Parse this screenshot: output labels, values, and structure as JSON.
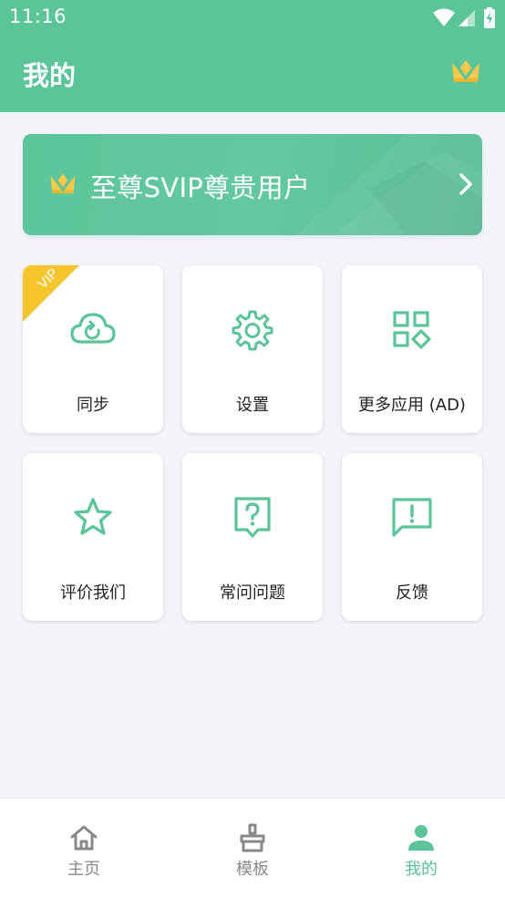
{
  "status_bar": {
    "time": "11:16"
  },
  "header": {
    "title": "我的",
    "crown_icon": "crown-icon"
  },
  "banner": {
    "text": "至尊SVIP尊贵用户",
    "icon": "crown-icon",
    "arrow_icon": "chevron-right-icon"
  },
  "grid": {
    "items": [
      {
        "label": "同步",
        "icon": "cloud-sync-icon",
        "badge": "VIP"
      },
      {
        "label": "设置",
        "icon": "gear-icon"
      },
      {
        "label": "更多应用 (AD)",
        "icon": "apps-grid-icon"
      },
      {
        "label": "评价我们",
        "icon": "star-icon"
      },
      {
        "label": "常问问题",
        "icon": "help-question-icon"
      },
      {
        "label": "反馈",
        "icon": "feedback-icon"
      }
    ]
  },
  "tabbar": {
    "tabs": [
      {
        "label": "主页",
        "icon": "home-icon",
        "active": false
      },
      {
        "label": "模板",
        "icon": "template-brush-icon",
        "active": false
      },
      {
        "label": "我的",
        "icon": "person-icon",
        "active": true
      }
    ]
  },
  "colors": {
    "brand": "#5bc499",
    "icon_green": "#5bc499",
    "tab_inactive": "#888888",
    "vip_gold": "#f6c42c",
    "background": "#f4f5fa"
  }
}
